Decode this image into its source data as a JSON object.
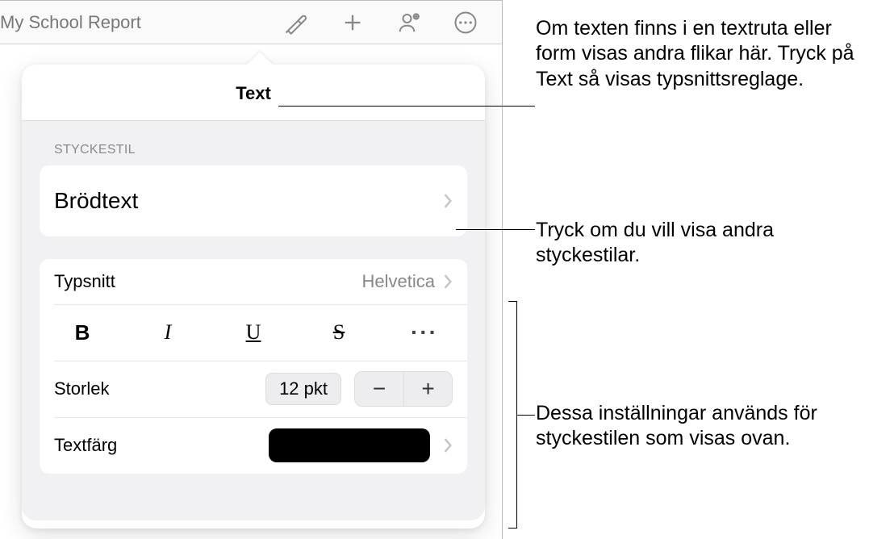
{
  "toolbar": {
    "document_title": "My School Report"
  },
  "popover": {
    "header": "Text",
    "section_label": "STYCKESTIL",
    "style_name": "Brödtext",
    "font_label": "Typsnitt",
    "font_value": "Helvetica",
    "size_label": "Storlek",
    "size_value": "12 pkt",
    "color_label": "Textfärg",
    "format": {
      "bold": "B",
      "italic": "I",
      "underline": "U",
      "strike": "S",
      "more": "···"
    },
    "stepper": {
      "minus": "−",
      "plus": "+"
    },
    "text_color_hex": "#000000"
  },
  "callouts": {
    "text_tab": "Om texten finns i en textruta eller form visas andra flikar här. Tryck på Text så visas typsnittsreglage.",
    "paragraph_style": "Tryck om du vill visa andra styckestilar.",
    "settings_bracket": "Dessa inställningar används för styckestilen som visas ovan."
  }
}
